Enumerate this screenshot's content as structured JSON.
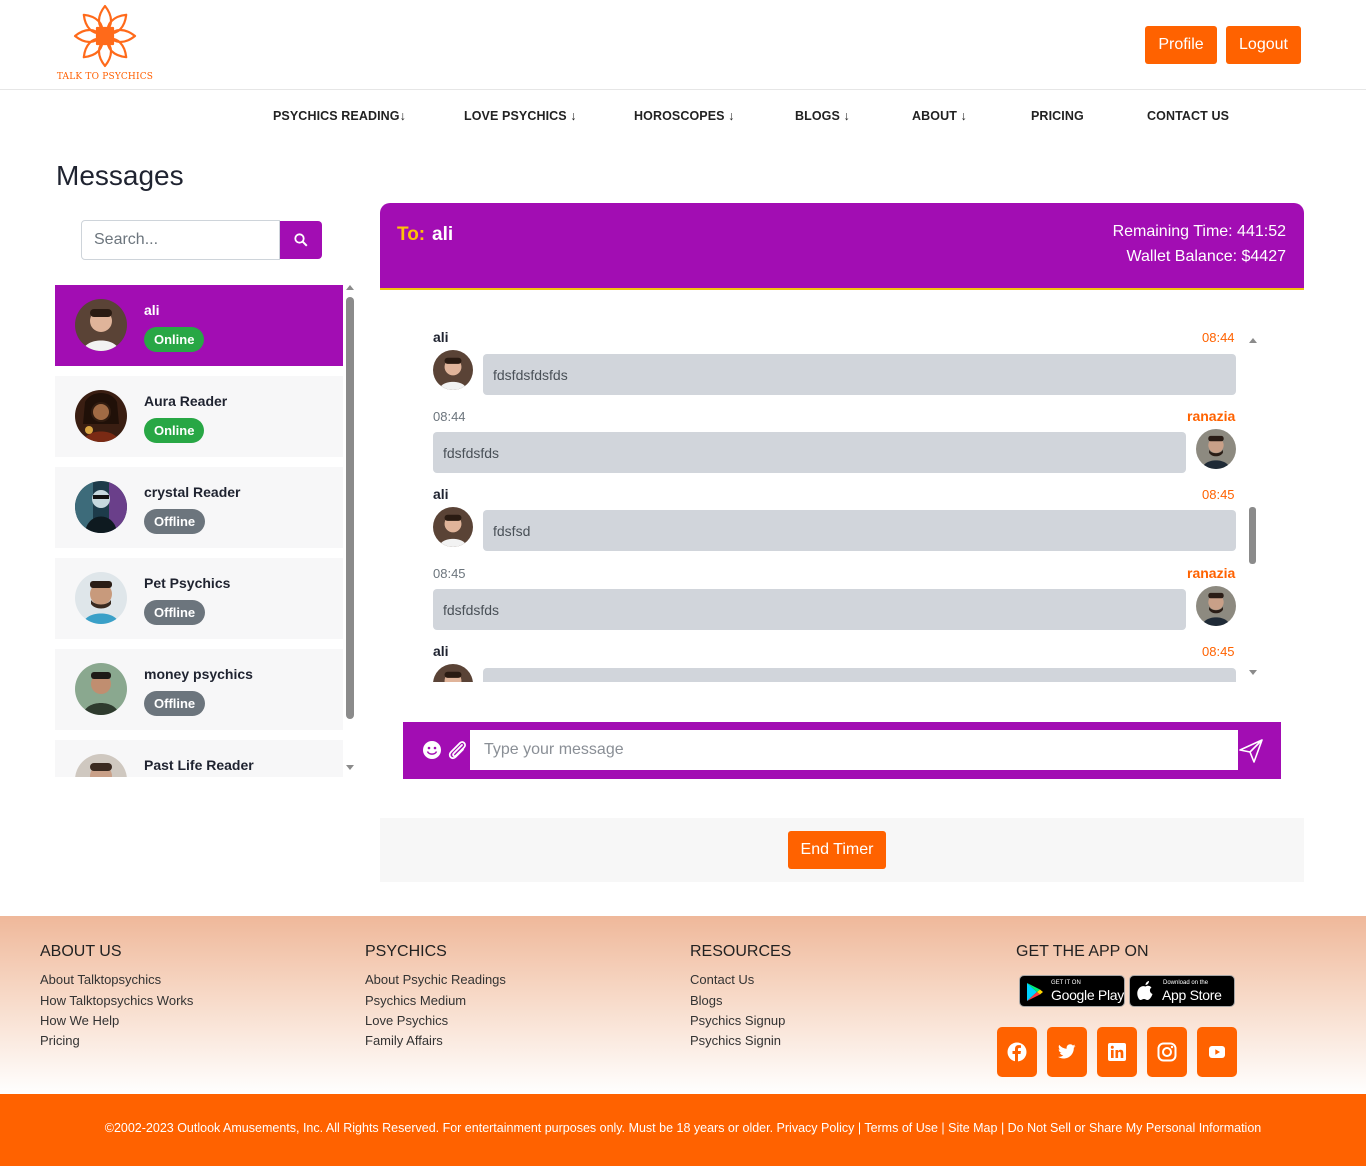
{
  "brand": {
    "logo_text": "TALK TO PSYCHICS",
    "accent": "#ff6200",
    "purple": "#a20db3"
  },
  "header": {
    "profile_label": "Profile",
    "logout_label": "Logout"
  },
  "nav": {
    "items": [
      "PSYCHICS READING↓",
      "LOVE PSYCHICS ↓",
      "HOROSCOPES ↓",
      "BLOGS ↓",
      "ABOUT ↓",
      "PRICING",
      "CONTACT US"
    ]
  },
  "page": {
    "title": "Messages"
  },
  "search": {
    "placeholder": "Search...",
    "icon": "search-icon"
  },
  "contacts": [
    {
      "name": "ali",
      "status": "Online",
      "active": true
    },
    {
      "name": "Aura Reader",
      "status": "Online",
      "active": false
    },
    {
      "name": "crystal Reader",
      "status": "Offline",
      "active": false
    },
    {
      "name": "Pet Psychics",
      "status": "Offline",
      "active": false
    },
    {
      "name": "money psychics",
      "status": "Offline",
      "active": false
    },
    {
      "name": "Past Life Reader",
      "status": "",
      "active": false
    }
  ],
  "chat": {
    "to_label": "To:",
    "to_name": "ali",
    "remaining_time": "Remaining Time: 441:52",
    "wallet_balance": "Wallet Balance: $4427",
    "messages": [
      {
        "sender": "ali",
        "time": "08:44",
        "text": "fdsfdsfdsfds",
        "side": "left"
      },
      {
        "sender": "ranazia",
        "time": "08:44",
        "text": "fdsfdsfds",
        "side": "right"
      },
      {
        "sender": "ali",
        "time": "08:45",
        "text": "fdsfsd",
        "side": "left"
      },
      {
        "sender": "ranazia",
        "time": "08:45",
        "text": "fdsfdsfds",
        "side": "right"
      },
      {
        "sender": "ali",
        "time": "08:45",
        "text": "",
        "side": "left"
      }
    ],
    "composer_placeholder": "Type your message",
    "end_timer_label": "End Timer"
  },
  "footer": {
    "about": {
      "title": "ABOUT US",
      "links": [
        "About Talktopsychics",
        "How Talktopsychics Works",
        "How We Help",
        "Pricing"
      ]
    },
    "psychics": {
      "title": "PSYCHICS",
      "links": [
        "About Psychic Readings",
        "Psychics Medium",
        "Love Psychics",
        "Family Affairs"
      ]
    },
    "resources": {
      "title": "RESOURCES",
      "links": [
        "Contact Us",
        "Blogs",
        "Psychics Signup",
        "Psychics Signin"
      ]
    },
    "app": {
      "title": "GET THE APP ON",
      "google_small": "GET IT ON",
      "google_big": "Google Play",
      "apple_small": "Download on the",
      "apple_big": "App Store"
    },
    "social_icons": [
      "facebook-icon",
      "twitter-icon",
      "linkedin-icon",
      "instagram-icon",
      "youtube-icon"
    ],
    "copyright": "©2002-2023 Outlook Amusements, Inc. All Rights Reserved. For entertainment purposes only. Must be 18 years or older. Privacy Policy | Terms of Use | Site Map | Do Not Sell or Share My Personal Information"
  }
}
